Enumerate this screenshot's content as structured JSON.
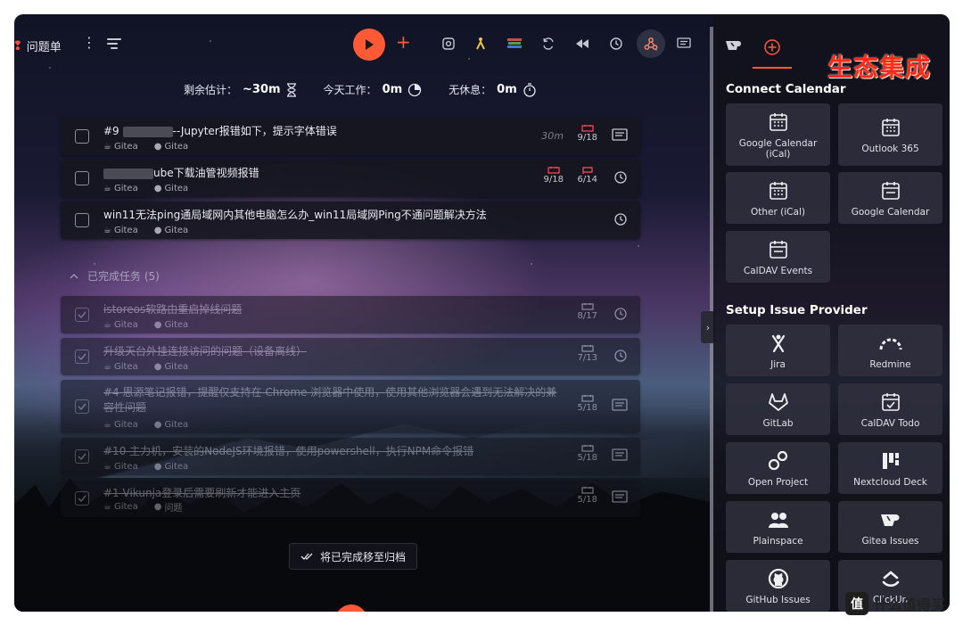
{
  "app": {
    "title": "问题单"
  },
  "stats": {
    "estimate_label": "剩余估计：",
    "estimate_value": "~30m",
    "today_label": "今天工作：",
    "today_value": "0m",
    "break_label": "无休息：",
    "break_value": "0m"
  },
  "tasks": [
    {
      "title_prefix": "#9",
      "title_suffix": "--Jupyter报错如下，提示字体错误",
      "source1": "Gitea",
      "source2": "Gitea",
      "estimate": "30m",
      "due": "9/18"
    },
    {
      "title_prefix": "",
      "title_suffix": "ube下载油管视频报错",
      "source1": "Gitea",
      "source2": "Gitea",
      "date1": "9/18",
      "date2": "6/14"
    },
    {
      "title": "win11无法ping通局域网内其他电脑怎么办_win11局域网Ping不通问题解决方法",
      "source1": "Gitea",
      "source2": "Gitea"
    }
  ],
  "done_header": "已完成任务 (5)",
  "done_tasks": [
    {
      "title": "istoreos软路由重启掉线问题",
      "source1": "Gitea",
      "source2": "Gitea",
      "date": "8/17"
    },
    {
      "title": "升级天台外挂连接访问的问题（设备离线）",
      "source1": "Gitea",
      "source2": "Gitea",
      "date": "7/13"
    },
    {
      "title": "#4 思源笔记报错，提醒仅支持在 Chrome 浏览器中使用，使用其他浏览器会遇到无法解决的兼容性问题",
      "source1": "Gitea",
      "source2": "Gitea",
      "date": "5/18"
    },
    {
      "title": "#10 主力机，安装的NodeJS环境报错，使用powershell，执行NPM命令报错",
      "source1": "Gitea",
      "source2": "Gitea",
      "date": "5/18"
    },
    {
      "title": "#1 Vikunja登录后需要刷新才能进入主页",
      "source1": "Gitea",
      "source2": "问题",
      "date": "5/18"
    }
  ],
  "archive_label": "将已完成移至归档",
  "panel": {
    "brand": "生态集成",
    "connect_title": "Connect Calendar",
    "calendars": [
      "Google Calendar (iCal)",
      "Outlook 365",
      "Other (iCal)",
      "Google Calendar",
      "CalDAV Events"
    ],
    "provider_title": "Setup Issue Provider",
    "providers": [
      "Jira",
      "Redmine",
      "GitLab",
      "CalDAV Todo",
      "Open Project",
      "Nextcloud Deck",
      "Plainspace",
      "Gitea Issues",
      "GitHub Issues",
      "ClickUp"
    ]
  },
  "watermark": {
    "logo": "值",
    "text": "什么值得买"
  },
  "colors": {
    "accent": "#ff5a36",
    "brand_red": "#ff2a1a",
    "overdue": "#ff4d5a"
  }
}
